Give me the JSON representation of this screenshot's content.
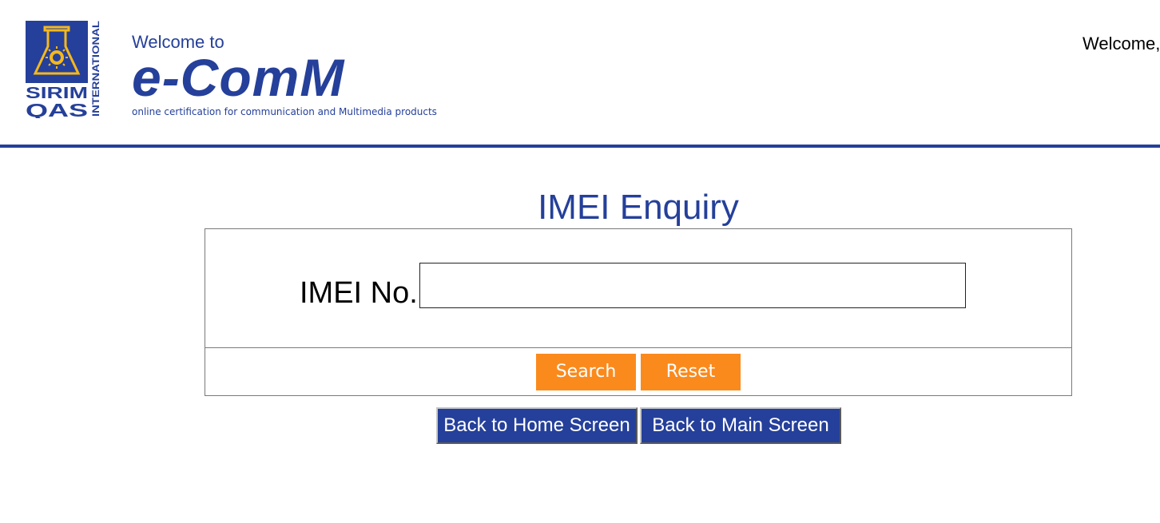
{
  "header": {
    "logo": {
      "icon": "sirim-qas-logo",
      "text_line1": "SIRIM",
      "text_line2": "QAS",
      "text_vertical": "INTERNATIONAL",
      "colors": {
        "blue": "#25409a",
        "gold": "#f5b81c"
      }
    },
    "welcome_to": "Welcome to",
    "app_name": "e-ComM",
    "tagline": "online certification for communication and Multimedia products",
    "welcome_user": "Welcome,"
  },
  "main": {
    "title": "IMEI Enquiry",
    "imei_label": "IMEI No.",
    "imei_value": "",
    "imei_placeholder": "",
    "search_label": "Search",
    "reset_label": "Reset",
    "back_home_label": "Back to Home Screen",
    "back_main_label": "Back to Main Screen"
  },
  "colors": {
    "brand_blue": "#25409a",
    "button_orange": "#fb8a1d",
    "white": "#ffffff"
  }
}
